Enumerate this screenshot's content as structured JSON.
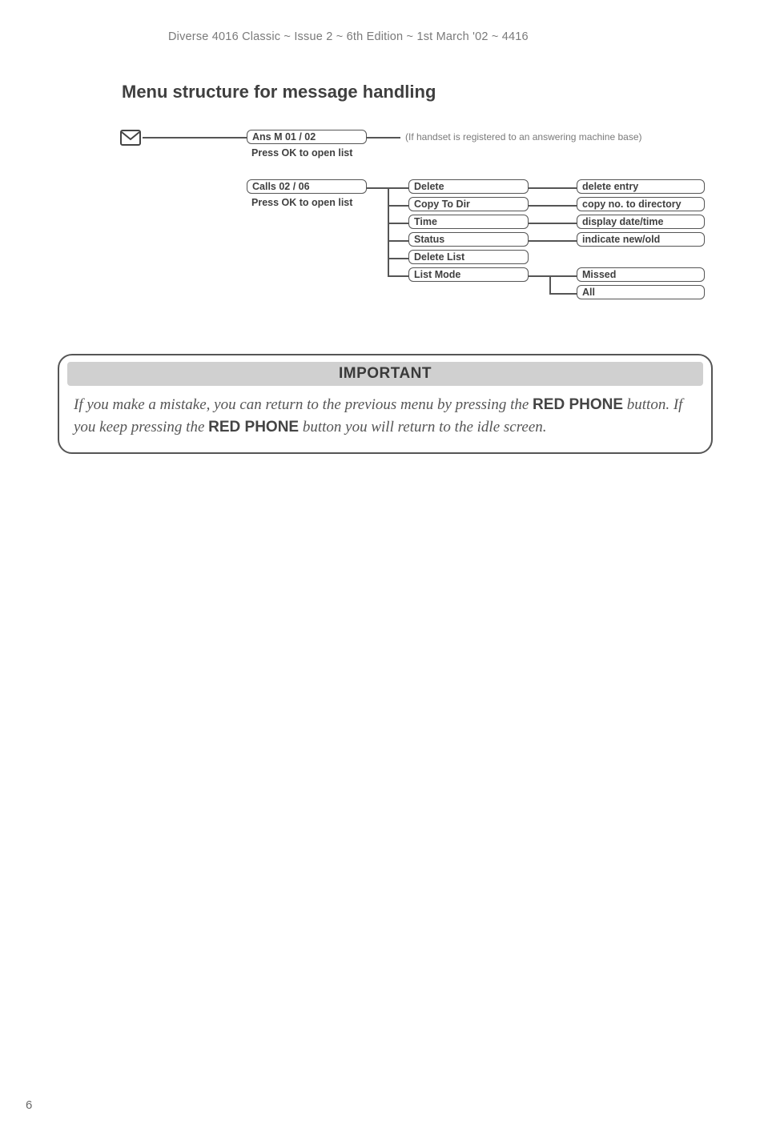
{
  "header": "Diverse 4016 Classic ~ Issue 2 ~ 6th Edition ~ 1st March '02 ~ 4416",
  "section_title": "Menu structure for message handling",
  "diagram": {
    "ans": {
      "label": "Ans M 01 / 02",
      "sub": "Press OK to open list",
      "note": "(If handset is registered to an answering machine base)"
    },
    "calls": {
      "label": "Calls 02 / 06",
      "sub": "Press OK to open list"
    },
    "col2": {
      "delete": "Delete",
      "copy": "Copy To Dir",
      "time": "Time",
      "status": "Status",
      "delete_list": "Delete List",
      "list_mode": "List Mode"
    },
    "col3": {
      "delete_entry": "delete entry",
      "copy_dir": "copy no. to directory",
      "display_dt": "display date/time",
      "indicate": "indicate new/old",
      "missed": "Missed",
      "all": "All"
    }
  },
  "callout": {
    "title": "IMPORTANT",
    "t1": "If you make a mistake, you can return to the previous menu by pressing the ",
    "b1": "RED PHONE",
    "t2": " button. If you keep pressing the ",
    "b2": "RED PHONE",
    "t3": " button you will return to the idle screen."
  },
  "page_number": "6"
}
